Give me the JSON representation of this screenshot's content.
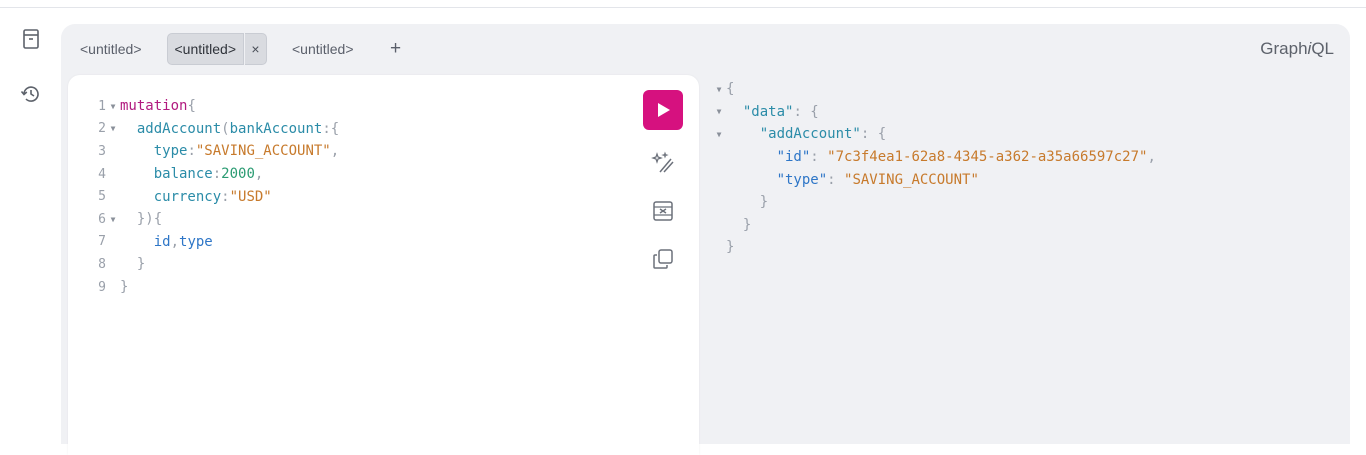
{
  "sidebar": {
    "icons": [
      "document-icon",
      "history-icon"
    ]
  },
  "tabs": [
    {
      "label": "<untitled>"
    },
    {
      "label": "<untitled>",
      "close": "×"
    },
    {
      "label": "<untitled>"
    }
  ],
  "tab_add": "+",
  "brand": {
    "prefix": "Graph",
    "italic": "i",
    "suffix": "QL"
  },
  "editor": {
    "lines": [
      {
        "n": "1",
        "t1": "mutation",
        "t2": "{"
      },
      {
        "n": "2",
        "t1": "addAccount",
        "t2": "(",
        "t3": "bankAccount",
        "t4": ":{"
      },
      {
        "n": "3",
        "t1": "type",
        "t2": ":",
        "t3": "\"SAVING_ACCOUNT\"",
        "t4": ","
      },
      {
        "n": "4",
        "t1": "balance",
        "t2": ":",
        "t3": "2000",
        "t4": ","
      },
      {
        "n": "5",
        "t1": "currency",
        "t2": ":",
        "t3": "\"USD\""
      },
      {
        "n": "6",
        "t1": "}){"
      },
      {
        "n": "7",
        "t1": "id",
        "t2": ",",
        "t3": "type"
      },
      {
        "n": "8",
        "t1": "}"
      },
      {
        "n": "9",
        "t1": "}"
      }
    ]
  },
  "toolbar": {
    "run": "play-icon",
    "prettify": "magic-wand-icon",
    "merge": "merge-fragments-icon",
    "copy": "copy-icon"
  },
  "result": {
    "l1": "{",
    "l2k": "\"data\"",
    "l2p": ": {",
    "l3k": "\"addAccount\"",
    "l3p": ": {",
    "l4k": "\"id\"",
    "l4p": ": ",
    "l4v": "\"7c3f4ea1-62a8-4345-a362-a35a66597c27\"",
    "l4c": ",",
    "l5k": "\"type\"",
    "l5p": ": ",
    "l5v": "\"SAVING_ACCOUNT\"",
    "l6": "}",
    "l7": "}",
    "l8": "}"
  },
  "colors": {
    "accent": "#d6117f",
    "background": "#f0f1f4"
  }
}
